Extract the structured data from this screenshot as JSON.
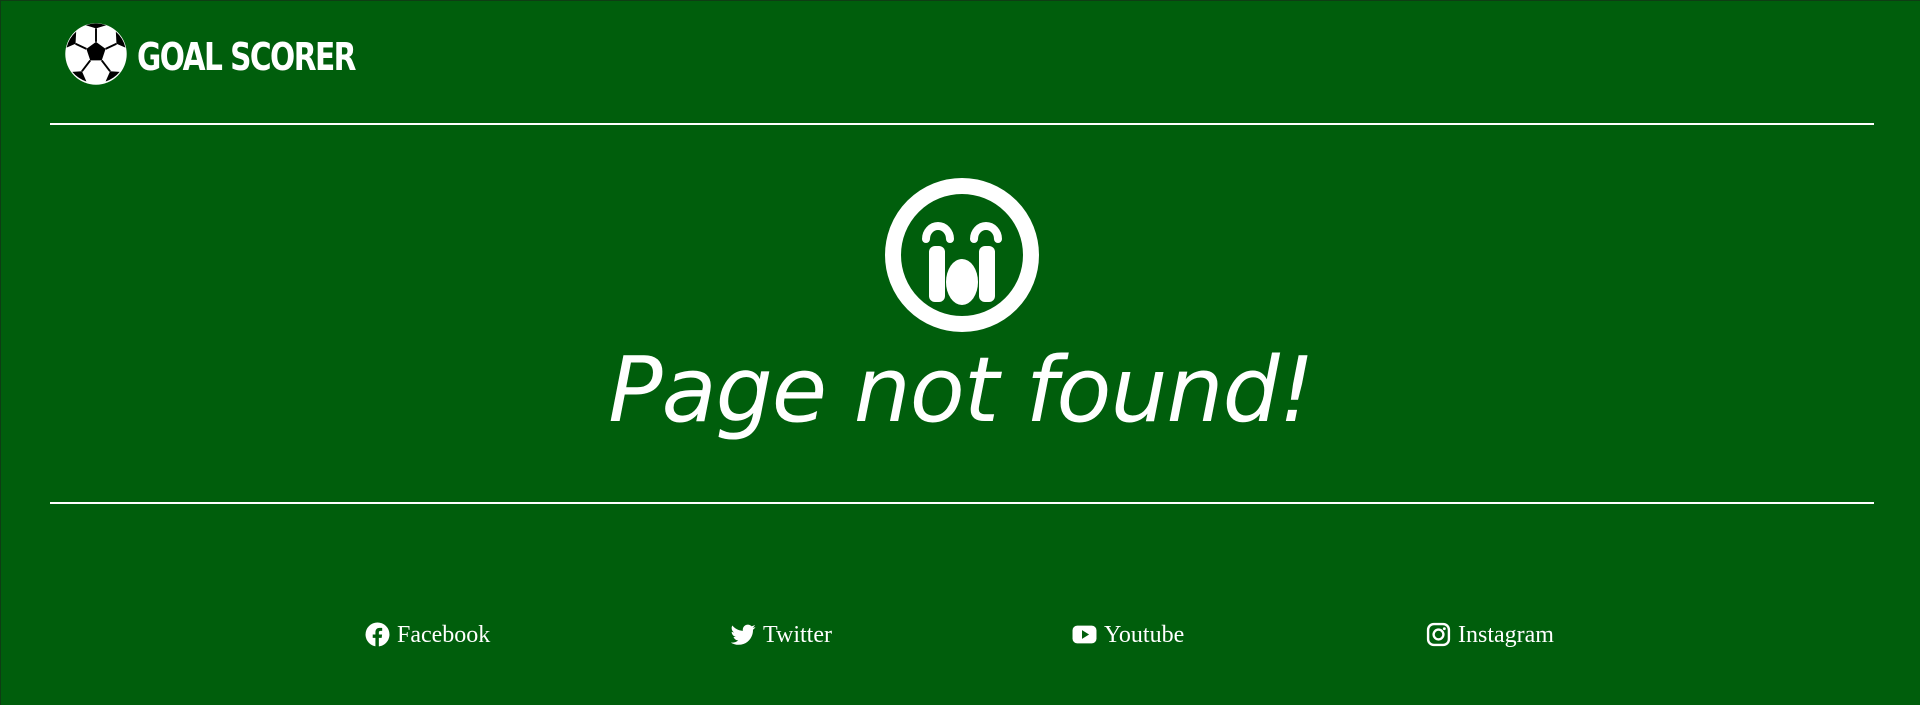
{
  "header": {
    "brand_name": "GOAL SCORER",
    "logo_icon": "soccer-ball-icon"
  },
  "main": {
    "status_icon": "crying-face-icon",
    "message": "Page not found!"
  },
  "footer": {
    "social_links": [
      {
        "label": "Facebook",
        "icon": "facebook-icon"
      },
      {
        "label": "Twitter",
        "icon": "twitter-icon"
      },
      {
        "label": "Youtube",
        "icon": "youtube-icon"
      },
      {
        "label": "Instagram",
        "icon": "instagram-icon"
      }
    ]
  },
  "colors": {
    "background": "#005e0c",
    "foreground": "#ffffff",
    "logo_dark": "#000000"
  }
}
